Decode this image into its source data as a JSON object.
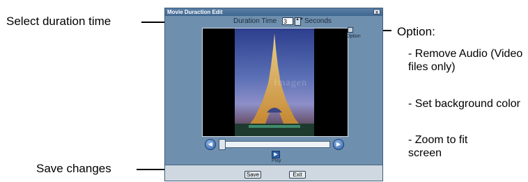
{
  "callouts": {
    "select_duration": "Select duration time",
    "save_changes": "Save changes",
    "option_heading": "Option:",
    "option_items": [
      "- Remove Audio (Video files only)",
      "- Set background color",
      "- Zoom to fit screen"
    ]
  },
  "dialog": {
    "title": "Movie Duraction Edit",
    "close_glyph": "x",
    "duration_label": "Duration Time",
    "duration_value": "3",
    "spin_glyph": "▲▼",
    "duration_unit": "Seconds",
    "option_label": "Option",
    "watermark": "Imagen",
    "play_label": "Play",
    "play_glyph": "▶",
    "prev_glyph": "◀",
    "next_glyph": "▶",
    "save_label": "Save",
    "exit_label": "Exit"
  }
}
